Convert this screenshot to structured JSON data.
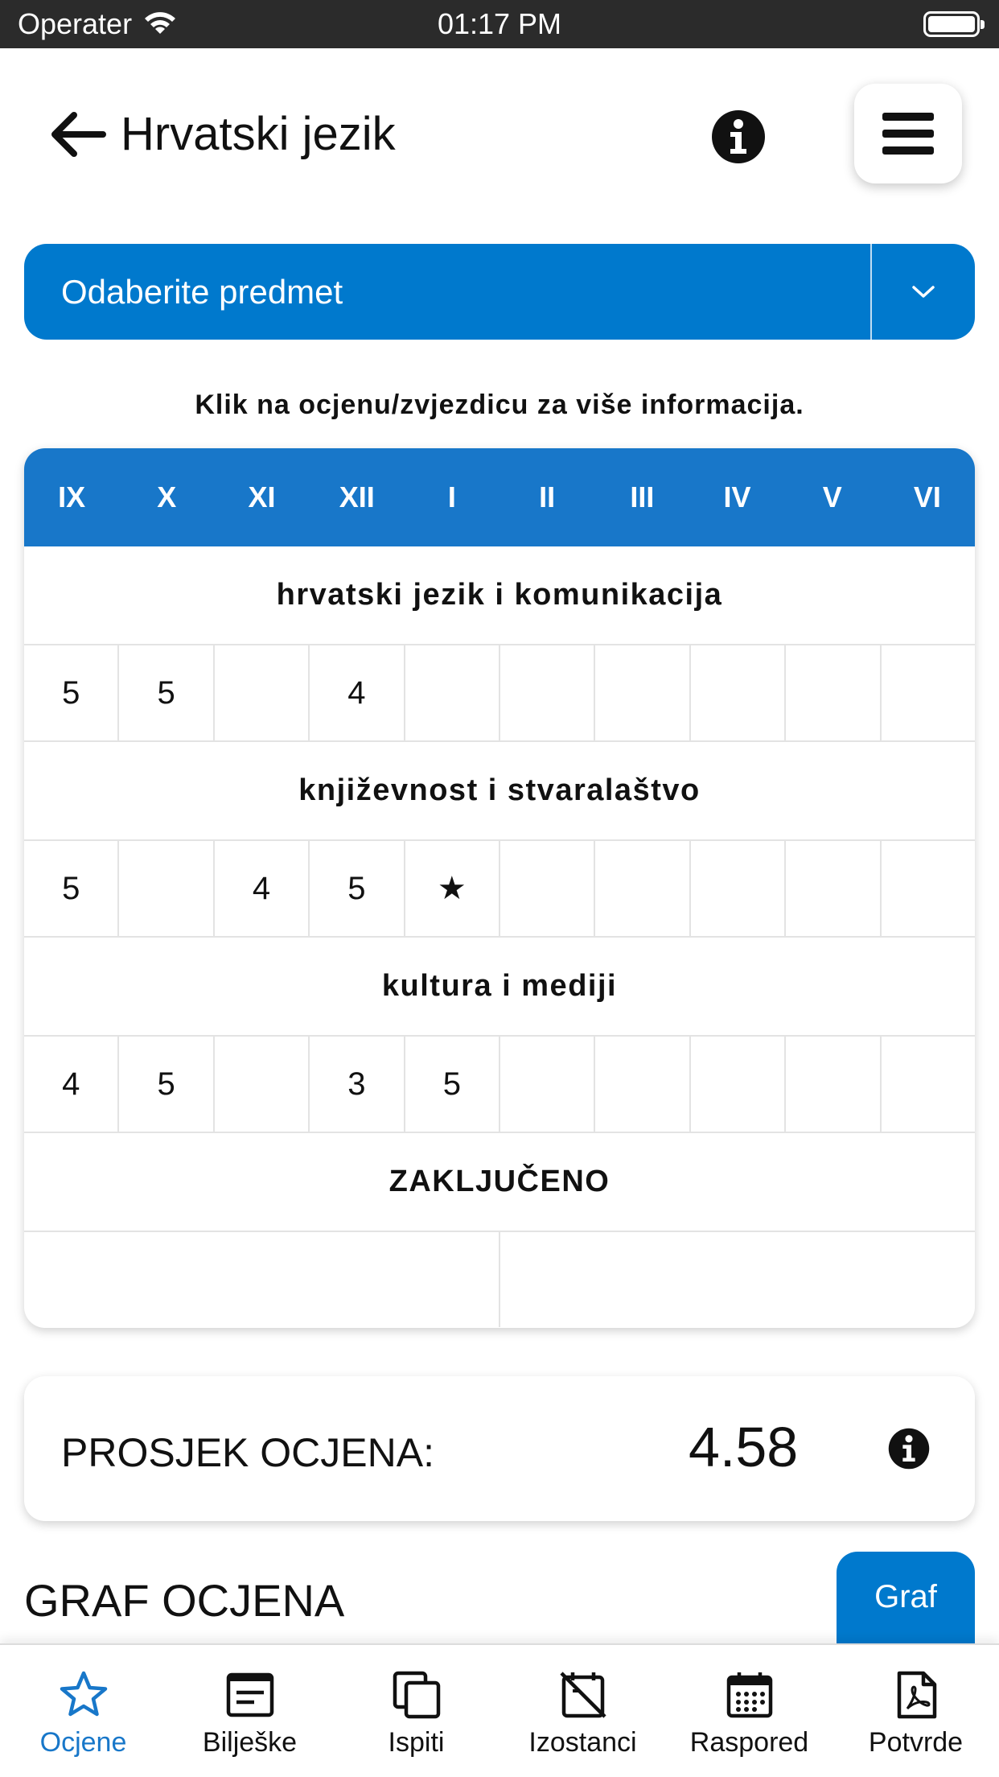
{
  "status_bar": {
    "carrier": "Operater",
    "time": "01:17 PM"
  },
  "header": {
    "title": "Hrvatski jezik"
  },
  "subject_select": {
    "label": "Odaberite predmet"
  },
  "hint": "Klik na ocjenu/zvjezdicu za više informacija.",
  "months": [
    "IX",
    "X",
    "XI",
    "XII",
    "I",
    "II",
    "III",
    "IV",
    "V",
    "VI"
  ],
  "sections": [
    {
      "title": "hrvatski jezik i komunikacija",
      "grades": [
        "5",
        "5",
        "",
        "4",
        "",
        "",
        "",
        "",
        "",
        ""
      ]
    },
    {
      "title": "književnost i stvaralaštvo",
      "grades": [
        "5",
        "",
        "4",
        "5",
        "★",
        "",
        "",
        "",
        "",
        ""
      ]
    },
    {
      "title": "kultura i mediji",
      "grades": [
        "4",
        "5",
        "",
        "3",
        "5",
        "",
        "",
        "",
        "",
        ""
      ]
    }
  ],
  "final": {
    "title": "ZAKLJUČENO"
  },
  "average": {
    "label": "PROSJEK OCJENA:",
    "value": "4.58"
  },
  "graph": {
    "title": "GRAF OCJENA",
    "button_label": "Graf"
  },
  "tabs": [
    {
      "label": "Ocjene",
      "icon": "star-icon",
      "active": true
    },
    {
      "label": "Bilješke",
      "icon": "notes-icon",
      "active": false
    },
    {
      "label": "Ispiti",
      "icon": "exams-icon",
      "active": false
    },
    {
      "label": "Izostanci",
      "icon": "absence-icon",
      "active": false
    },
    {
      "label": "Raspored",
      "icon": "calendar-icon",
      "active": false
    },
    {
      "label": "Potvrde",
      "icon": "pdf-icon",
      "active": false
    }
  ],
  "colors": {
    "primary": "#0079cd",
    "header_blue": "#1877c9",
    "active_tab": "#1877c9"
  }
}
